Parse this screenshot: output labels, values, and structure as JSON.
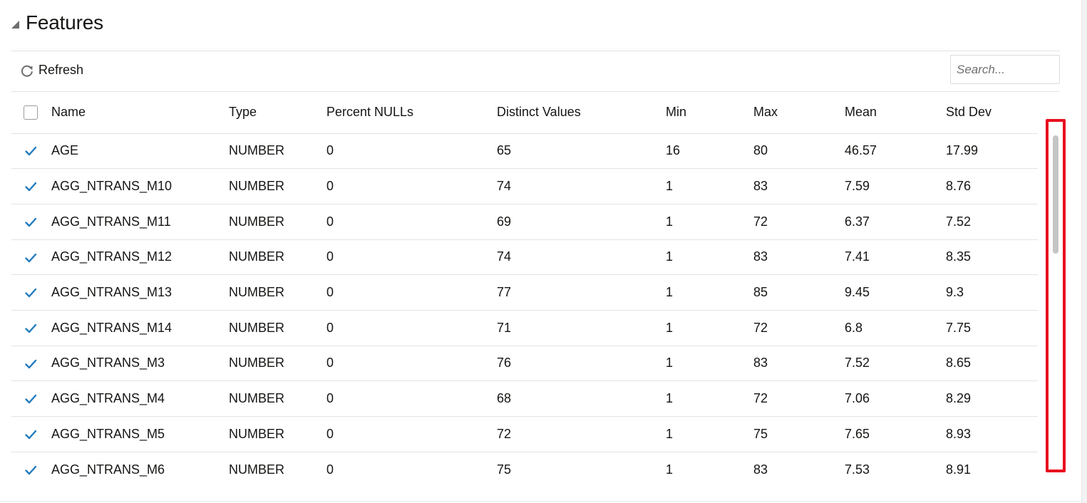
{
  "section": {
    "title": "Features"
  },
  "toolbar": {
    "refresh_label": "Refresh",
    "search_placeholder": "Search..."
  },
  "table": {
    "columns": [
      "Name",
      "Type",
      "Percent NULLs",
      "Distinct Values",
      "Min",
      "Max",
      "Mean",
      "Std Dev"
    ],
    "rows": [
      {
        "checked": true,
        "cells": [
          "AGE",
          "NUMBER",
          "0",
          "65",
          "16",
          "80",
          "46.57",
          "17.99"
        ]
      },
      {
        "checked": true,
        "cells": [
          "AGG_NTRANS_M10",
          "NUMBER",
          "0",
          "74",
          "1",
          "83",
          "7.59",
          "8.76"
        ]
      },
      {
        "checked": true,
        "cells": [
          "AGG_NTRANS_M11",
          "NUMBER",
          "0",
          "69",
          "1",
          "72",
          "6.37",
          "7.52"
        ]
      },
      {
        "checked": true,
        "cells": [
          "AGG_NTRANS_M12",
          "NUMBER",
          "0",
          "74",
          "1",
          "83",
          "7.41",
          "8.35"
        ]
      },
      {
        "checked": true,
        "cells": [
          "AGG_NTRANS_M13",
          "NUMBER",
          "0",
          "77",
          "1",
          "85",
          "9.45",
          "9.3"
        ]
      },
      {
        "checked": true,
        "cells": [
          "AGG_NTRANS_M14",
          "NUMBER",
          "0",
          "71",
          "1",
          "72",
          "6.8",
          "7.75"
        ]
      },
      {
        "checked": true,
        "cells": [
          "AGG_NTRANS_M3",
          "NUMBER",
          "0",
          "76",
          "1",
          "83",
          "7.52",
          "8.65"
        ]
      },
      {
        "checked": true,
        "cells": [
          "AGG_NTRANS_M4",
          "NUMBER",
          "0",
          "68",
          "1",
          "72",
          "7.06",
          "8.29"
        ]
      },
      {
        "checked": true,
        "cells": [
          "AGG_NTRANS_M5",
          "NUMBER",
          "0",
          "72",
          "1",
          "75",
          "7.65",
          "8.93"
        ]
      },
      {
        "checked": true,
        "cells": [
          "AGG_NTRANS_M6",
          "NUMBER",
          "0",
          "75",
          "1",
          "83",
          "7.53",
          "8.91"
        ]
      }
    ]
  },
  "icons": {
    "collapse": "collapse-triangle-icon",
    "refresh": "refresh-icon",
    "checkbox": "checkbox-icon"
  },
  "colors": {
    "accent": "#227bbd",
    "highlight": "#e8101e",
    "border": "#e3e3e3",
    "scrollbar": "#c5c5c5"
  }
}
